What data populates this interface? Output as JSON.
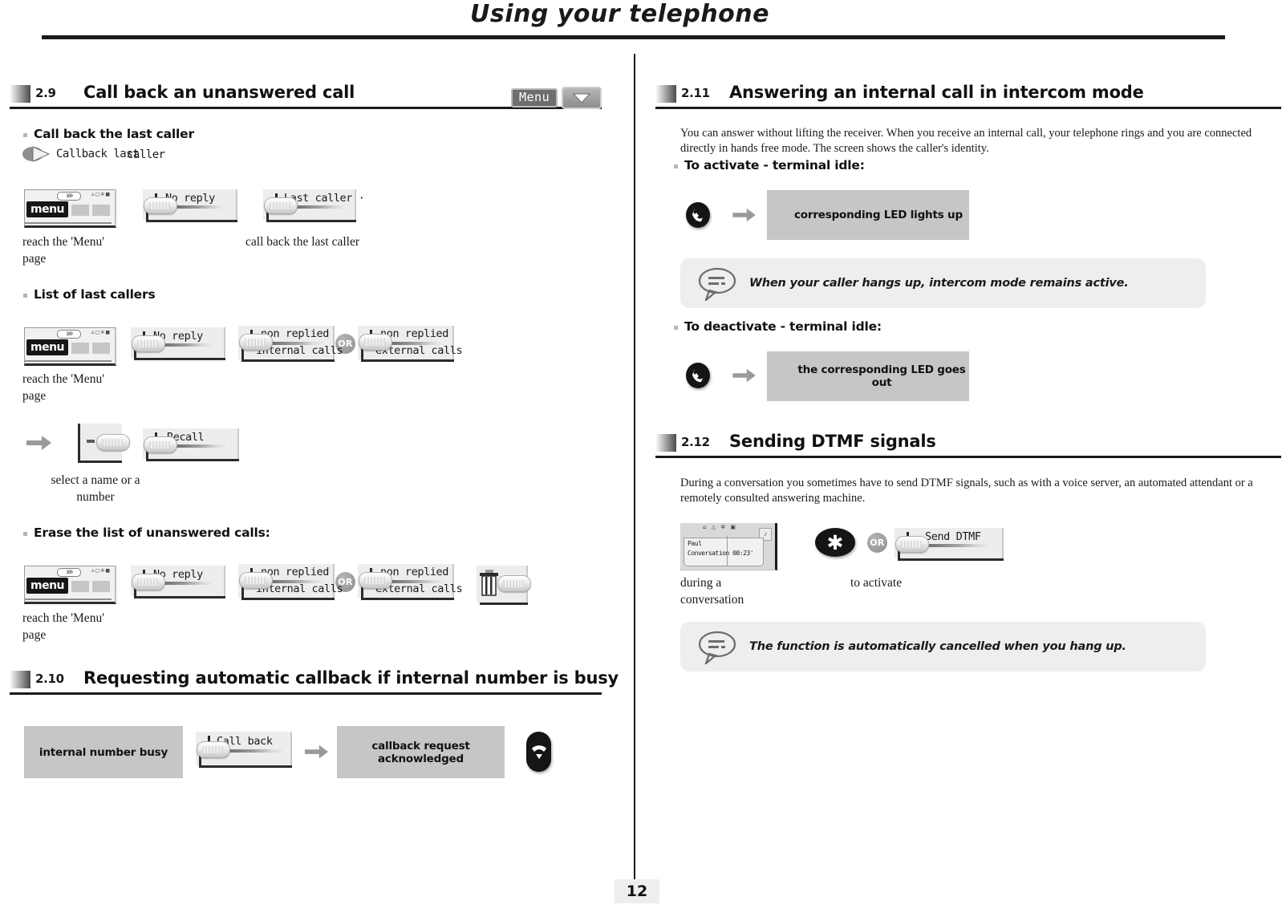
{
  "page": {
    "title": "Using your telephone",
    "number": "12"
  },
  "colors": {
    "accent_dark": "#1a1a1a",
    "grey_box": "#c6c6c6",
    "note_bg": "#eeeeee",
    "softkey_bg": "#eceded",
    "or_badge": "#8e8e8e"
  },
  "left_column": {
    "section_29": {
      "number": "2.9",
      "title": "Call back an unanswered call",
      "menu_badge": "Menu",
      "sub_1": {
        "heading": "Call back the last caller",
        "feature_code_1": "Callback last",
        "feature_code_2": "caller",
        "display_menu": {
          "pill": "100",
          "icons": "⌂□✲■",
          "menu_label": "menu"
        },
        "softkey_no_reply": "No reply",
        "softkey_last_caller": "Last caller ·",
        "caption_menu": "reach the 'Menu' page",
        "caption_callback": "call back the last caller"
      },
      "sub_2": {
        "heading": "List of last callers",
        "display_menu": {
          "pill": "100",
          "icons": "⌂□✲■",
          "menu_label": "menu"
        },
        "softkey_no_reply": "No reply",
        "softkey_internal_l1": "non replied",
        "softkey_internal_l2": "internal calls",
        "or_label": "OR",
        "softkey_external_l1": "non replied",
        "softkey_external_l2": "external calls",
        "caption_menu": "reach the 'Menu' page",
        "softkey_recall": "Recall",
        "caption_select": "select a name or a number"
      },
      "sub_3": {
        "heading": "Erase the list of unanswered calls:",
        "display_menu": {
          "pill": "100",
          "icons": "⌂□✲■",
          "menu_label": "menu"
        },
        "softkey_no_reply": "No reply",
        "softkey_internal_l1": "non replied",
        "softkey_internal_l2": "internal calls",
        "or_label": "OR",
        "softkey_external_l1": "non replied",
        "softkey_external_l2": "external calls",
        "caption_menu": "reach the 'Menu' page"
      }
    },
    "section_210": {
      "number": "2.10",
      "title": "Requesting automatic callback if internal number is busy",
      "status_busy": "internal number busy",
      "softkey_call_back": "Call back",
      "status_ack": "callback request acknowledged"
    }
  },
  "right_column": {
    "section_211": {
      "number": "2.11",
      "title": "Answering an internal call in intercom mode",
      "intro": "You can answer without lifting the receiver. When you receive an internal call, your telephone rings and you are connected directly in hands free mode. The screen shows the caller's identity.",
      "sub_activate": {
        "heading": "To activate - terminal idle:",
        "result": "corresponding LED lights up"
      },
      "note": "When your caller hangs up, intercom mode remains active.",
      "sub_deactivate": {
        "heading": "To deactivate - terminal idle:",
        "result": "the corresponding LED goes out"
      }
    },
    "section_212": {
      "number": "2.12",
      "title": "Sending DTMF signals",
      "intro": "During a conversation you sometimes have to send DTMF signals, such as with a voice server, an automated attendant or a remotely consulted answering machine.",
      "display": {
        "top_icons": "⌂ △ ✲ ▣",
        "corner_icon": "♪",
        "name": "Paul",
        "status": "Conversation 00:23'"
      },
      "caption_during": "during a conversation",
      "star_key": "✱",
      "or_label": "OR",
      "softkey_send_dtmf": "Send DTMF",
      "caption_activate": "to activate",
      "note": "The function is automatically cancelled when you hang up."
    }
  }
}
